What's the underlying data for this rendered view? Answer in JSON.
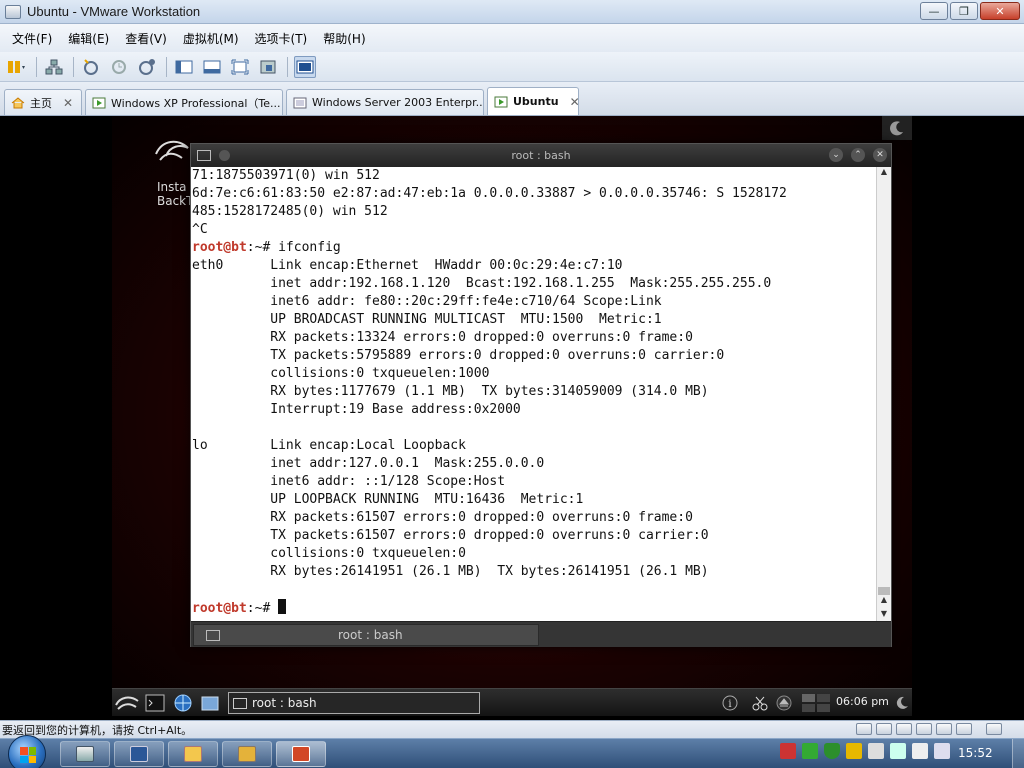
{
  "window": {
    "title": "Ubuntu - VMware Workstation",
    "min": "—",
    "max": "❐",
    "close": "✕"
  },
  "menu": [
    "文件(F)",
    "编辑(E)",
    "查看(V)",
    "虚拟机(M)",
    "选项卡(T)",
    "帮助(H)"
  ],
  "tabs": [
    {
      "label": "主页",
      "active": false
    },
    {
      "label": "Windows XP Professional（Te...",
      "active": false
    },
    {
      "label": "Windows Server 2003 Enterpr...",
      "active": false
    },
    {
      "label": "Ubuntu",
      "active": true
    }
  ],
  "tab_close": "✕",
  "desktop": {
    "icon_label_1": "Insta",
    "icon_label_2": "BackTr"
  },
  "terminal": {
    "title": "root : bash",
    "tab_label": "root : bash",
    "prompt_user": "root@bt",
    "prompt_rest": ":~# ",
    "lines": [
      {
        "text": "71:1875503971(0) win 512"
      },
      {
        "text": "6d:7e:c6:61:83:50 e2:87:ad:47:eb:1a 0.0.0.0.33887 > 0.0.0.0.35746: S 1528172"
      },
      {
        "text": "485:1528172485(0) win 512"
      },
      {
        "text": "^C"
      },
      {
        "prompt": true,
        "text": "ifconfig"
      },
      {
        "text": "eth0      Link encap:Ethernet  HWaddr 00:0c:29:4e:c7:10"
      },
      {
        "text": "          inet addr:192.168.1.120  Bcast:192.168.1.255  Mask:255.255.255.0"
      },
      {
        "text": "          inet6 addr: fe80::20c:29ff:fe4e:c710/64 Scope:Link"
      },
      {
        "text": "          UP BROADCAST RUNNING MULTICAST  MTU:1500  Metric:1"
      },
      {
        "text": "          RX packets:13324 errors:0 dropped:0 overruns:0 frame:0"
      },
      {
        "text": "          TX packets:5795889 errors:0 dropped:0 overruns:0 carrier:0"
      },
      {
        "text": "          collisions:0 txqueuelen:1000"
      },
      {
        "text": "          RX bytes:1177679 (1.1 MB)  TX bytes:314059009 (314.0 MB)"
      },
      {
        "text": "          Interrupt:19 Base address:0x2000"
      },
      {
        "text": ""
      },
      {
        "text": "lo        Link encap:Local Loopback"
      },
      {
        "text": "          inet addr:127.0.0.1  Mask:255.0.0.0"
      },
      {
        "text": "          inet6 addr: ::1/128 Scope:Host"
      },
      {
        "text": "          UP LOOPBACK RUNNING  MTU:16436  Metric:1"
      },
      {
        "text": "          RX packets:61507 errors:0 dropped:0 overruns:0 frame:0"
      },
      {
        "text": "          TX packets:61507 errors:0 dropped:0 overruns:0 carrier:0"
      },
      {
        "text": "          collisions:0 txqueuelen:0"
      },
      {
        "text": "          RX bytes:26141951 (26.1 MB)  TX bytes:26141951 (26.1 MB)"
      },
      {
        "text": ""
      },
      {
        "prompt": true,
        "text": "",
        "cursor": true
      }
    ]
  },
  "guest_panel": {
    "task_label": "root : bash",
    "clock": "06:06 pm"
  },
  "statusbar": {
    "message": "要返回到您的计算机，请按 Ctrl+Alt。"
  },
  "taskbar": {
    "clock": "15:52"
  },
  "colors": {
    "prompt": "#c0392b",
    "desktop_red": "#7a0d0d",
    "taskbar": "#2f4f78"
  }
}
